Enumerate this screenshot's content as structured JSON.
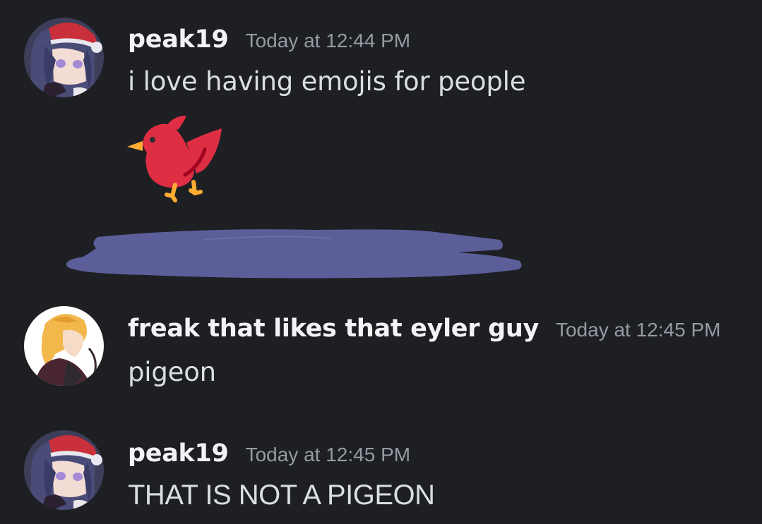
{
  "messages": [
    {
      "username": "peak19",
      "timestamp": "Today at 12:44 PM",
      "content": "i love having emojis for people",
      "emoji": "red-bird-emoji"
    },
    {
      "username": "freak that likes that eyler guy",
      "timestamp": "Today at 12:45 PM",
      "content": "pigeon"
    },
    {
      "username": "peak19",
      "timestamp": "Today at 12:45 PM",
      "content": "THAT IS NOT A PIGEON"
    }
  ],
  "colors": {
    "background": "#1e1f22",
    "username": "#f2f3f5",
    "timestamp": "#949ba4",
    "message_text": "#dbdee1",
    "redaction_scribble": "#5b5e99",
    "bird_red": "#dd2e44",
    "bird_feet": "#ffac33"
  }
}
